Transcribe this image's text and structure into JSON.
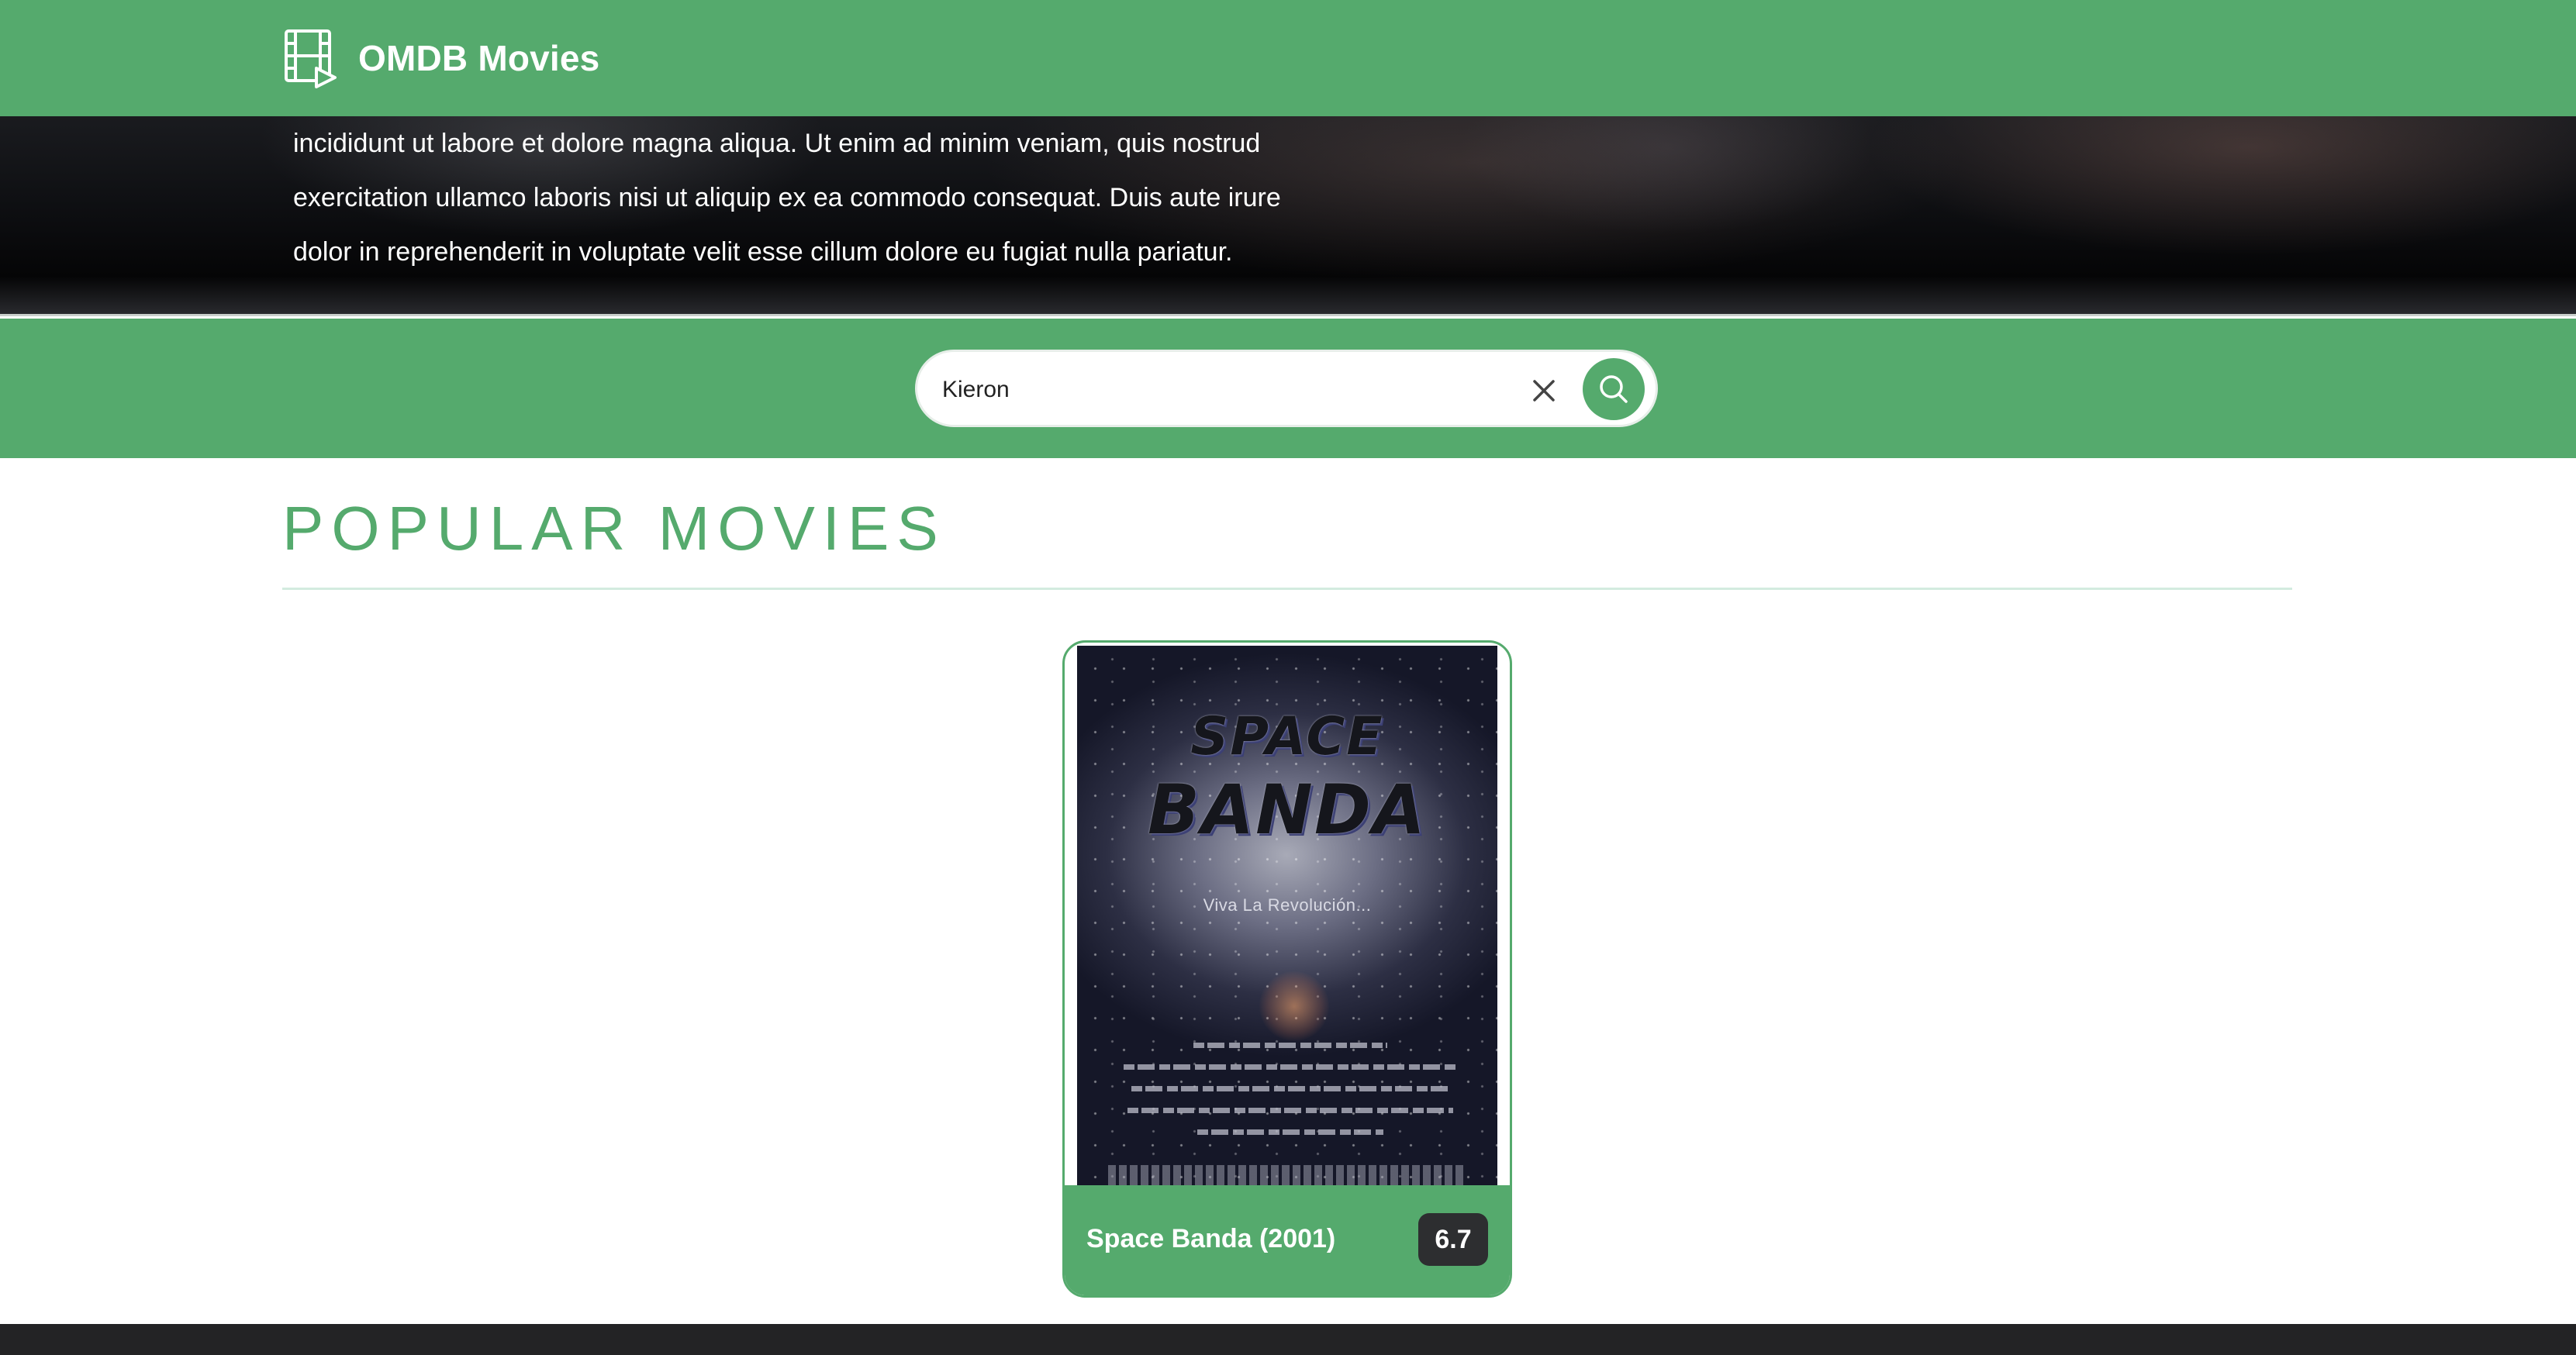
{
  "navbar": {
    "brand_label": "OMDB Movies",
    "brand_icon": "film-play-icon",
    "background_color": "#55aa6d"
  },
  "hero": {
    "lines": [
      "incididunt ut labore et dolore magna aliqua. Ut enim ad minim veniam, quis nostrud",
      "exercitation ullamco laboris nisi ut aliquip ex ea commodo consequat. Duis aute irure",
      "dolor in reprehenderit in voluptate velit esse cillum dolore eu fugiat nulla pariatur."
    ]
  },
  "search": {
    "value": "Kieron",
    "clear_icon": "close-icon",
    "submit_icon": "search-icon"
  },
  "section": {
    "title": "POPULAR MOVIES"
  },
  "movies": [
    {
      "title": "Space Banda (2001)",
      "rating": "6.7",
      "poster": {
        "title_line1": "SPACE",
        "title_line2": "BANDA",
        "tagline": "Viva La Revolución..."
      }
    }
  ],
  "colors": {
    "accent": "#55aa6d",
    "rating_badge": "#2d2e30",
    "footer": "#232325"
  }
}
